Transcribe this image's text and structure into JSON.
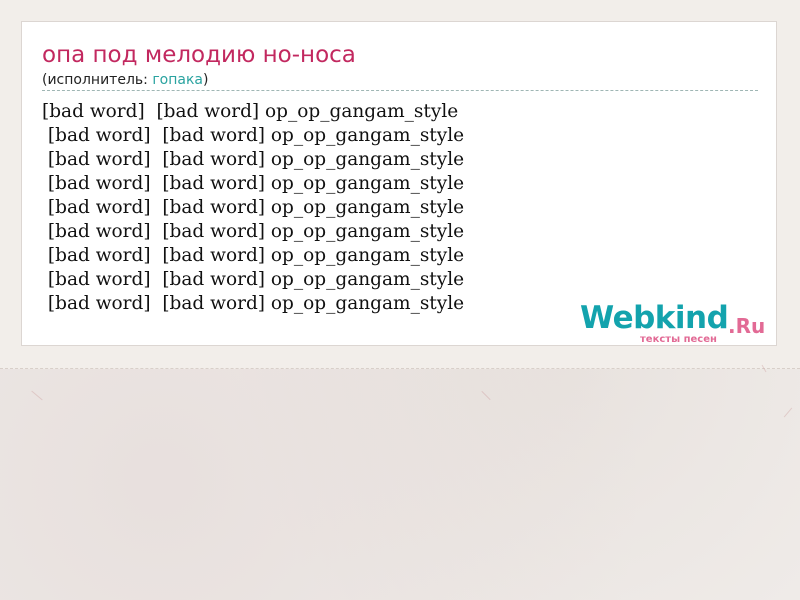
{
  "song": {
    "title": "опа под мелодию но-носа",
    "performer_prefix": "(исполнитель: ",
    "performer_name": "гопака",
    "performer_suffix": ")"
  },
  "lyrics": {
    "lines": [
      "[bad word]  [bad word] op_op_gangam_style",
      " [bad word]  [bad word] op_op_gangam_style",
      " [bad word]  [bad word] op_op_gangam_style",
      " [bad word]  [bad word] op_op_gangam_style",
      " [bad word]  [bad word] op_op_gangam_style",
      " [bad word]  [bad word] op_op_gangam_style",
      " [bad word]  [bad word] op_op_gangam_style",
      " [bad word]  [bad word] op_op_gangam_style",
      " [bad word]  [bad word] op_op_gangam_style"
    ]
  },
  "logo": {
    "brand": "Webkind",
    "tld": ".Ru",
    "tagline": "тексты песен",
    "brand_color": "#13a3ad",
    "accent_color": "#e26a95"
  },
  "colors": {
    "title": "#c2285f",
    "link": "#2aa3a0",
    "page_background": "#efebe8"
  }
}
